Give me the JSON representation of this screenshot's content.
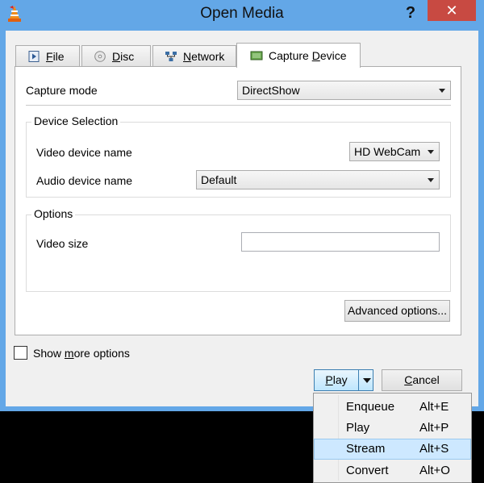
{
  "window": {
    "title": "Open Media",
    "help_glyph": "?",
    "close_glyph": "✕"
  },
  "tabs": [
    {
      "id": "file",
      "pre": "",
      "mnemonic": "F",
      "post": "ile",
      "icon": "file-icon"
    },
    {
      "id": "disc",
      "pre": "",
      "mnemonic": "D",
      "post": "isc",
      "icon": "disc-icon"
    },
    {
      "id": "network",
      "pre": "",
      "mnemonic": "N",
      "post": "etwork",
      "icon": "network-icon"
    },
    {
      "id": "capture",
      "pre": "Capture ",
      "mnemonic": "D",
      "post": "evice",
      "icon": "capture-device-icon",
      "active": true
    }
  ],
  "capture": {
    "mode_label": "Capture mode",
    "mode_value": "DirectShow",
    "device_group_title": "Device Selection",
    "video_label": "Video device name",
    "video_value": "HD WebCam",
    "audio_label": "Audio device name",
    "audio_value": "Default",
    "options_group_title": "Options",
    "video_size_label": "Video size",
    "video_size_value": "",
    "advanced_label": "Advanced options..."
  },
  "footer": {
    "show_more_pre": "Show ",
    "show_more_mnemonic": "m",
    "show_more_post": "ore options",
    "show_more_checked": false,
    "play_mnemonic": "P",
    "play_post": "lay",
    "cancel_mnemonic": "C",
    "cancel_post": "ancel"
  },
  "menu": [
    {
      "label": "Enqueue",
      "accel": "Alt+E",
      "highlighted": false
    },
    {
      "label": "Play",
      "accel": "Alt+P",
      "highlighted": false
    },
    {
      "label": "Stream",
      "accel": "Alt+S",
      "highlighted": true
    },
    {
      "label": "Convert",
      "accel": "Alt+O",
      "highlighted": false
    }
  ],
  "colors": {
    "title_bar": "#63a7e7",
    "close_button": "#c84a42",
    "menu_highlight": "#cde8ff"
  }
}
